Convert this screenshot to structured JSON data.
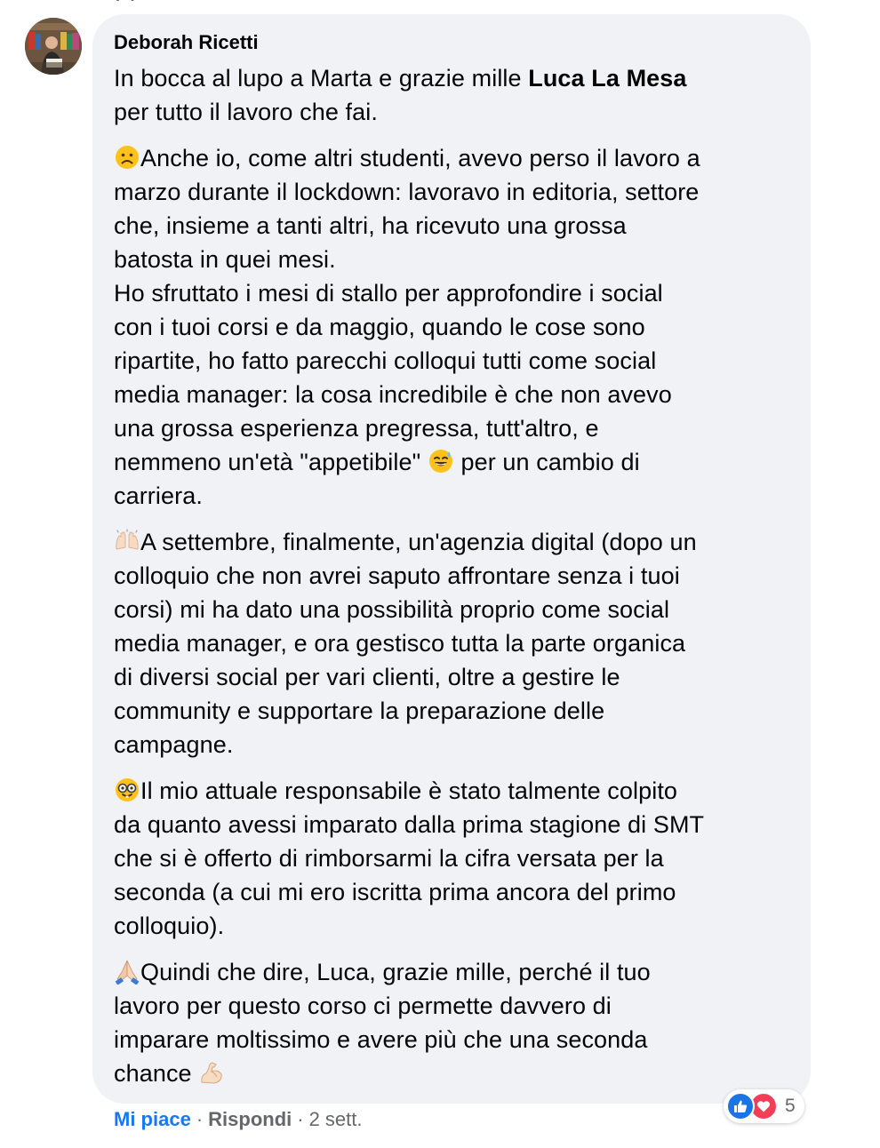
{
  "comment": {
    "author": "Deborah Ricetti",
    "paragraphs": [
      {
        "emoji": "",
        "lines": [
          {
            "pre": "In bocca al lupo a Marta e grazie mille ",
            "bold": "Luca La Mesa",
            "post": ""
          },
          {
            "pre": "per tutto il lavoro che fai.",
            "bold": "",
            "post": ""
          }
        ]
      },
      {
        "emoji": "frowning-face-emoji",
        "lines": [
          {
            "pre": "Anche io, come altri studenti, avevo perso il lavoro a"
          },
          {
            "pre": "marzo durante il lockdown: lavoravo in editoria, settore"
          },
          {
            "pre": "che, insieme a tanti altri, ha ricevuto una grossa"
          },
          {
            "pre": "batosta in quei mesi."
          },
          {
            "pre": "Ho sfruttato i mesi di stallo per approfondire i social"
          },
          {
            "pre": "con i tuoi corsi e da maggio, quando le cose sono"
          },
          {
            "pre": "ripartite, ho fatto parecchi colloqui tutti come social"
          },
          {
            "pre": "media manager: la cosa incredibile è che non avevo"
          },
          {
            "pre": "una grossa esperienza pregressa, tutt'altro, e"
          },
          {
            "pre": "nemmeno un'età \"appetibile\" ",
            "emoji_inline": "sweat-smile-emoji",
            "post": " per un cambio di"
          },
          {
            "pre": "carriera."
          }
        ]
      },
      {
        "emoji": "raising-hands-emoji",
        "lines": [
          {
            "pre": "A settembre, finalmente, un'agenzia digital (dopo un"
          },
          {
            "pre": "colloquio che non avrei saputo affrontare senza i tuoi"
          },
          {
            "pre": "corsi) mi ha dato una possibilità proprio come social"
          },
          {
            "pre": "media manager, e ora gestisco tutta la parte organica"
          },
          {
            "pre": "di diversi social per vari clienti, oltre a gestire le"
          },
          {
            "pre": "community e supportare la preparazione delle"
          },
          {
            "pre": "campagne."
          }
        ]
      },
      {
        "emoji": "nerd-face-emoji",
        "lines": [
          {
            "pre": "Il mio attuale responsabile è stato talmente colpito"
          },
          {
            "pre": "da quanto avessi imparato dalla prima stagione di SMT"
          },
          {
            "pre": "che si è offerto di rimborsarmi la cifra versata per la"
          },
          {
            "pre": "seconda (a cui mi ero iscritta prima ancora del primo"
          },
          {
            "pre": "colloquio)."
          }
        ]
      },
      {
        "emoji": "folded-hands-emoji",
        "lines": [
          {
            "pre": "Quindi che dire, Luca, grazie mille, perché il tuo"
          },
          {
            "pre": "lavoro per questo corso ci permette davvero di"
          },
          {
            "pre": "imparare moltissimo e avere più che una seconda"
          },
          {
            "pre": "chance ",
            "emoji_inline": "flexed-biceps-emoji",
            "post": ""
          }
        ]
      }
    ]
  },
  "actions": {
    "like_label": "Mi piace",
    "reply_label": "Rispondi",
    "separator": "·",
    "time": "2 sett."
  },
  "reactions": {
    "icons": [
      "like-reaction-icon",
      "love-reaction-icon"
    ],
    "count": "5",
    "colors": {
      "like": "#1b74e4",
      "love": "#f33e58",
      "link": "#1877f2",
      "muted": "#65676b",
      "bubble": "#f0f2f5"
    }
  }
}
